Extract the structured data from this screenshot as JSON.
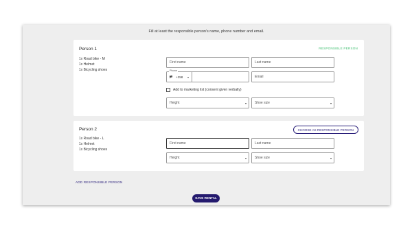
{
  "intro_text": "Fill at least the responsible person's name, phone number and email.",
  "persons": [
    {
      "title": "Person 1",
      "items": [
        "1x Road bike - M",
        "1x Helmet",
        "1x Bicycling shoes"
      ],
      "badge": "RESPONSIBLE PERSON",
      "fields": {
        "first_name": "First name",
        "last_name": "Last name",
        "phone_label": "Phone",
        "phone_flag": "🏴",
        "phone_code": "+358",
        "email": "Email",
        "marketing": "Add to marketing list (consent given verbally)",
        "height": "Height",
        "shoe_size": "Shoe size"
      }
    },
    {
      "title": "Person 2",
      "items": [
        "1x Road bike - L",
        "1x Helmet",
        "1x Bicycling shoes"
      ],
      "choose_button": "CHOOSE AS RESPONSIBLE PERSON",
      "fields": {
        "first_name": "First name",
        "last_name": "Last name",
        "height": "Height",
        "shoe_size": "Shoe size"
      }
    }
  ],
  "add_person_link": "ADD RESPONSIBLE PERSON",
  "save_button": "SAVE RENTAL",
  "colors": {
    "accent_navy": "#241a6e",
    "responsible_green": "#3fbf6f",
    "panel_bg": "#eeeeee",
    "card_bg": "#ffffff"
  },
  "icons": {
    "select_caret": "caret-down-icon",
    "phone_flag": "flag-icon"
  }
}
